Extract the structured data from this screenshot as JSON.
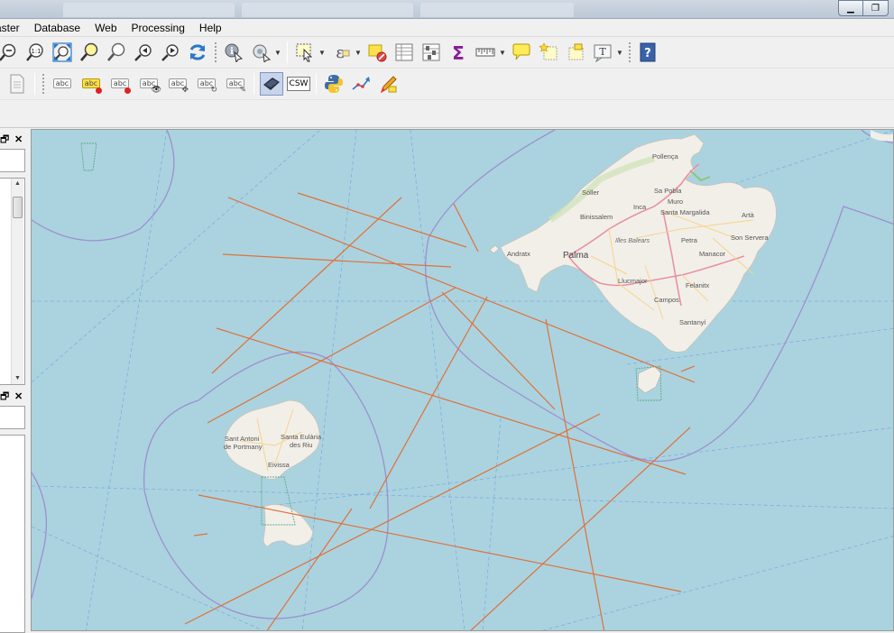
{
  "menu": {
    "items": [
      "aster",
      "Database",
      "Web",
      "Processing",
      "Help"
    ]
  },
  "toolbars": {
    "csw_label": "CSW",
    "identity_label": "1:1",
    "label_abc": "abc"
  },
  "map": {
    "places": {
      "pollenca": "Pollença",
      "soller": "Sóller",
      "sa_pobla": "Sa Pobla",
      "muro": "Muro",
      "inca": "Inca",
      "binissalem": "Binissalem",
      "santa_margalida": "Santa Margalida",
      "arta": "Artà",
      "illes_balears": "Illes Balears",
      "petra": "Petra",
      "son_servera": "Son Servera",
      "andratx": "Andratx",
      "palma": "Palma",
      "manacor": "Manacor",
      "llucmajor": "Llucmajor",
      "felanitx": "Felanitx",
      "campos": "Campos",
      "santanyi": "Santanyí",
      "sant_antoni_1": "Sant Antoni",
      "sant_antoni_2": "de Portmany",
      "santa_eulalia_1": "Santa Eulària",
      "santa_eulalia_2": "des Riu",
      "eivissa": "Eivissa"
    }
  },
  "colors": {
    "sea": "#aad3df",
    "land": "#f2efe9",
    "route_line": "#e0703a",
    "boundary": "#9e8fd0",
    "road": "#e892a2"
  }
}
